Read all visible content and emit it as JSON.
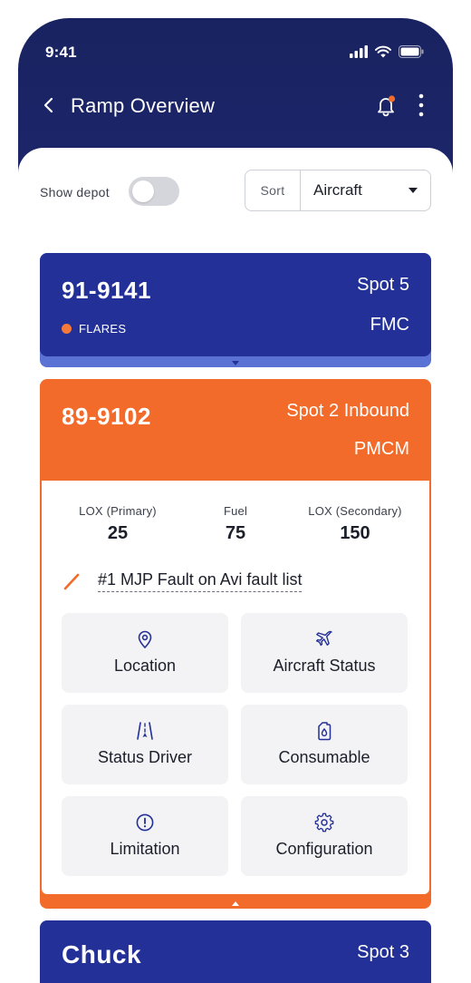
{
  "status_bar": {
    "time": "9:41"
  },
  "nav": {
    "title": "Ramp Overview"
  },
  "filters": {
    "show_depot_label": "Show depot",
    "show_depot_on": false,
    "sort_label": "Sort",
    "sort_value": "Aircraft"
  },
  "cards": [
    {
      "tail": "91-9141",
      "spot": "Spot 5",
      "tag": "FLARES",
      "status": "FMC",
      "expanded": false,
      "color": "#223097"
    },
    {
      "tail": "89-9102",
      "spot": "Spot 2 Inbound",
      "status": "PMCM",
      "expanded": true,
      "color": "#f36b2a",
      "metrics": [
        {
          "label": "LOX (Primary)",
          "value": "25"
        },
        {
          "label": "Fuel",
          "value": "75"
        },
        {
          "label": "LOX (Secondary)",
          "value": "150"
        }
      ],
      "fault": "#1 MJP Fault on Avi fault list",
      "actions": [
        {
          "label": "Location",
          "icon": "map-pin-icon"
        },
        {
          "label": "Aircraft Status",
          "icon": "airplane-icon"
        },
        {
          "label": "Status Driver",
          "icon": "runway-icon"
        },
        {
          "label": "Consumable",
          "icon": "fuel-can-icon"
        },
        {
          "label": "Limitation",
          "icon": "alert-circle-icon"
        },
        {
          "label": "Configuration",
          "icon": "gear-icon"
        }
      ]
    },
    {
      "tail": "Chuck",
      "spot": "Spot 3",
      "color": "#223097"
    }
  ],
  "colors": {
    "primary": "#223097",
    "accent": "#f36b2a",
    "header_gradient_top": "#1a2361"
  }
}
